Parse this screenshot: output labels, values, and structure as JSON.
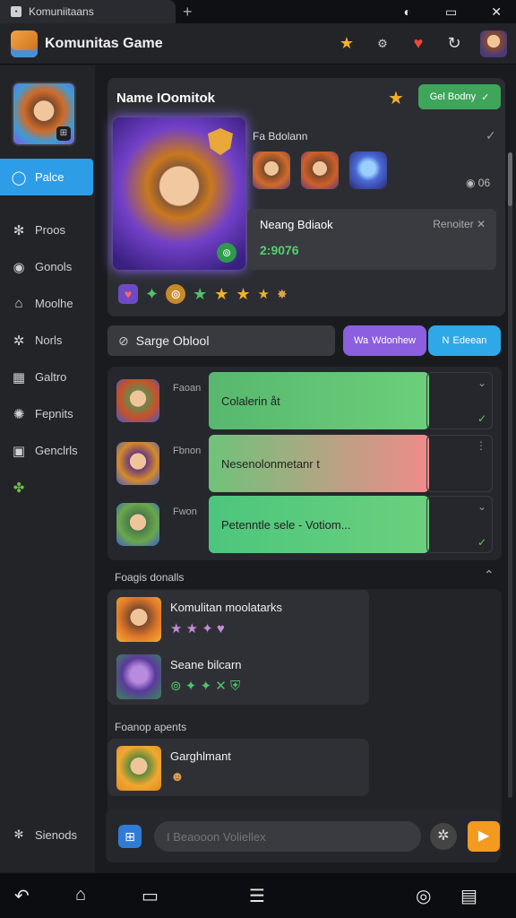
{
  "tab": {
    "title": "Komuniitaans",
    "plus": "+"
  },
  "window": {
    "b1": "◐",
    "b2": "▭",
    "b3": "✕"
  },
  "header": {
    "title": "Komunitas Game"
  },
  "sidebar": {
    "items": [
      {
        "label": "Palce",
        "icon": "◯"
      },
      {
        "label": "Proos",
        "icon": "✻"
      },
      {
        "label": "Gonols",
        "icon": "◉"
      },
      {
        "label": "Moolhe",
        "icon": "⌂"
      },
      {
        "label": "Norls",
        "icon": "✲"
      },
      {
        "label": "Galtro",
        "icon": "▦"
      },
      {
        "label": "Fepnits",
        "icon": "✺"
      },
      {
        "label": "Genclrls",
        "icon": "▣"
      },
      {
        "label": "",
        "icon": "✤"
      }
    ],
    "bottom": {
      "label": "Sienods",
      "icon": "✻"
    },
    "avatar_badge": "⊞"
  },
  "card": {
    "title": "Name IOomitok",
    "green_button": "Gel Bodny",
    "green_button_icon": "✓",
    "sub_title": "Fa Bdolann",
    "count": "◉ 06",
    "inner": {
      "title": "Neang Bdiaok",
      "right": "Renoiter",
      "value": "2:9076"
    }
  },
  "search": {
    "value": "Sarge Oblool"
  },
  "pills": {
    "purple": "Wdonhew",
    "purple_prefix": "Wa",
    "blue": "Edeean",
    "blue_prefix": "N"
  },
  "chat_rows": [
    {
      "label": "Faoan",
      "text": "Colalerin åt",
      "color_from": "#57b86e",
      "color_to": "#6ccf7a"
    },
    {
      "label": "Fbnon",
      "text": "Nesenolonmetanr t",
      "color_from": "#6ec37a",
      "color_to": "#f08a8a"
    },
    {
      "label": "Fwon",
      "text": "Petenntle sele - Votiom...",
      "color_from": "#4cc67d",
      "color_to": "#6bd07d"
    }
  ],
  "section1": {
    "title": "Foagis donalls",
    "items": [
      {
        "name": "Komulitan moolatarks",
        "icons": "★ ★ ✦ ♥"
      },
      {
        "name": "Seane bilcarn",
        "icons": "⊚ ✦ ✦ ✕ ⛨"
      }
    ]
  },
  "section2": {
    "title": "Foanop apents",
    "items": [
      {
        "name": "Garghlmant",
        "icons": "☻"
      }
    ]
  },
  "composer": {
    "placeholder": "I Beaooon Voliellex"
  },
  "sysbar": {
    "back": "↶",
    "home": "⌂",
    "recent": "▭",
    "apps": "☰",
    "lens": "◎",
    "doc": "▤"
  }
}
